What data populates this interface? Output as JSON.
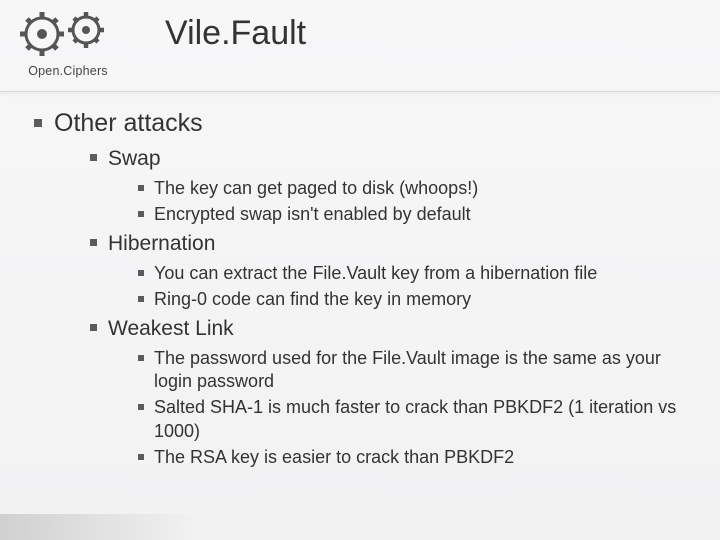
{
  "logo_text": "Open.Ciphers",
  "title": "Vile.Fault",
  "outline": {
    "heading": "Other attacks",
    "sections": [
      {
        "title": "Swap",
        "items": [
          "The key can get paged to disk (whoops!)",
          "Encrypted swap isn't enabled by default"
        ]
      },
      {
        "title": "Hibernation",
        "items": [
          "You can extract the File.Vault key from a hibernation file",
          "Ring-0 code can find the key in memory"
        ]
      },
      {
        "title": "Weakest Link",
        "items": [
          "The password used for the File.Vault image is the same as your login password",
          "Salted SHA-1 is much faster to crack than PBKDF2 (1 iteration vs 1000)",
          "The RSA key is easier to crack than PBKDF2"
        ]
      }
    ]
  }
}
